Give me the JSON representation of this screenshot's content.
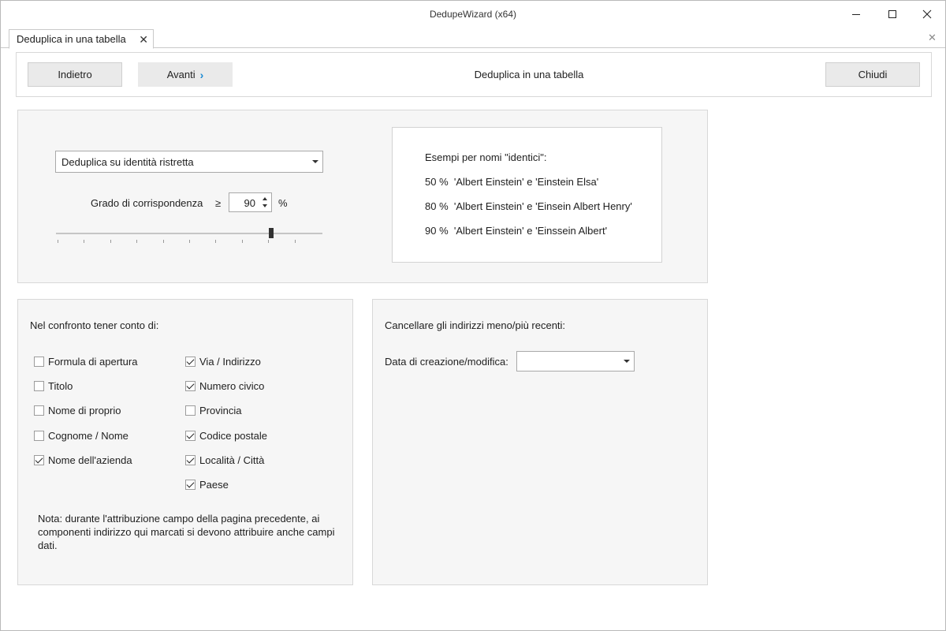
{
  "window": {
    "title": "DedupeWizard  (x64)",
    "controls": {
      "minimize": "─",
      "maximize": "☐",
      "close": "✕"
    }
  },
  "tabs": [
    {
      "label": "Deduplica in una tabella",
      "close": "✕"
    }
  ],
  "tabstrip_close": "✕",
  "toolbar": {
    "back_label": "Indietro",
    "next_label": "Avanti",
    "next_chevron": "›",
    "title": "Deduplica in una tabella",
    "close_label": "Chiudi"
  },
  "matching": {
    "mode_value": "Deduplica su identità ristretta",
    "degree_label": "Grado di corrispondenza",
    "geq_symbol": "≥",
    "degree_value": "90",
    "percent_symbol": "%",
    "slider_level": 0.9
  },
  "examples": {
    "heading": "Esempi per nomi \"identici\":",
    "lines": [
      "50 %  'Albert Einstein' e 'Einstein Elsa'",
      "80 %  'Albert Einstein' e 'Einsein Albert Henry'",
      "90 %  'Albert Einstein' e 'Einssein Albert'"
    ]
  },
  "compare": {
    "title": "Nel confronto tener conto di:",
    "left_column": [
      {
        "label": "Formula di apertura",
        "checked": false
      },
      {
        "label": "Titolo",
        "checked": false
      },
      {
        "label": "Nome di proprio",
        "checked": false
      },
      {
        "label": "Cognome / Nome",
        "checked": false
      },
      {
        "label": "Nome dell'azienda",
        "checked": true
      }
    ],
    "right_column": [
      {
        "label": "Via / Indirizzo",
        "checked": true
      },
      {
        "label": "Numero civico",
        "checked": true
      },
      {
        "label": "Provincia",
        "checked": false
      },
      {
        "label": "Codice postale",
        "checked": true
      },
      {
        "label": "Località / Città",
        "checked": true
      },
      {
        "label": "Paese",
        "checked": true
      }
    ],
    "note": "Nota: durante l'attribuzione campo della pagina precedente, ai componenti indirizzo qui marcati si devono attribuire anche campi dati."
  },
  "delete": {
    "title": "Cancellare gli indirizzi meno/più recenti:",
    "date_label": "Data di creazione/modifica:",
    "date_value": ""
  },
  "colors": {
    "accent": "#1a8ad4",
    "panel_bg": "#f6f6f6",
    "button_bg": "#eaeaea"
  }
}
